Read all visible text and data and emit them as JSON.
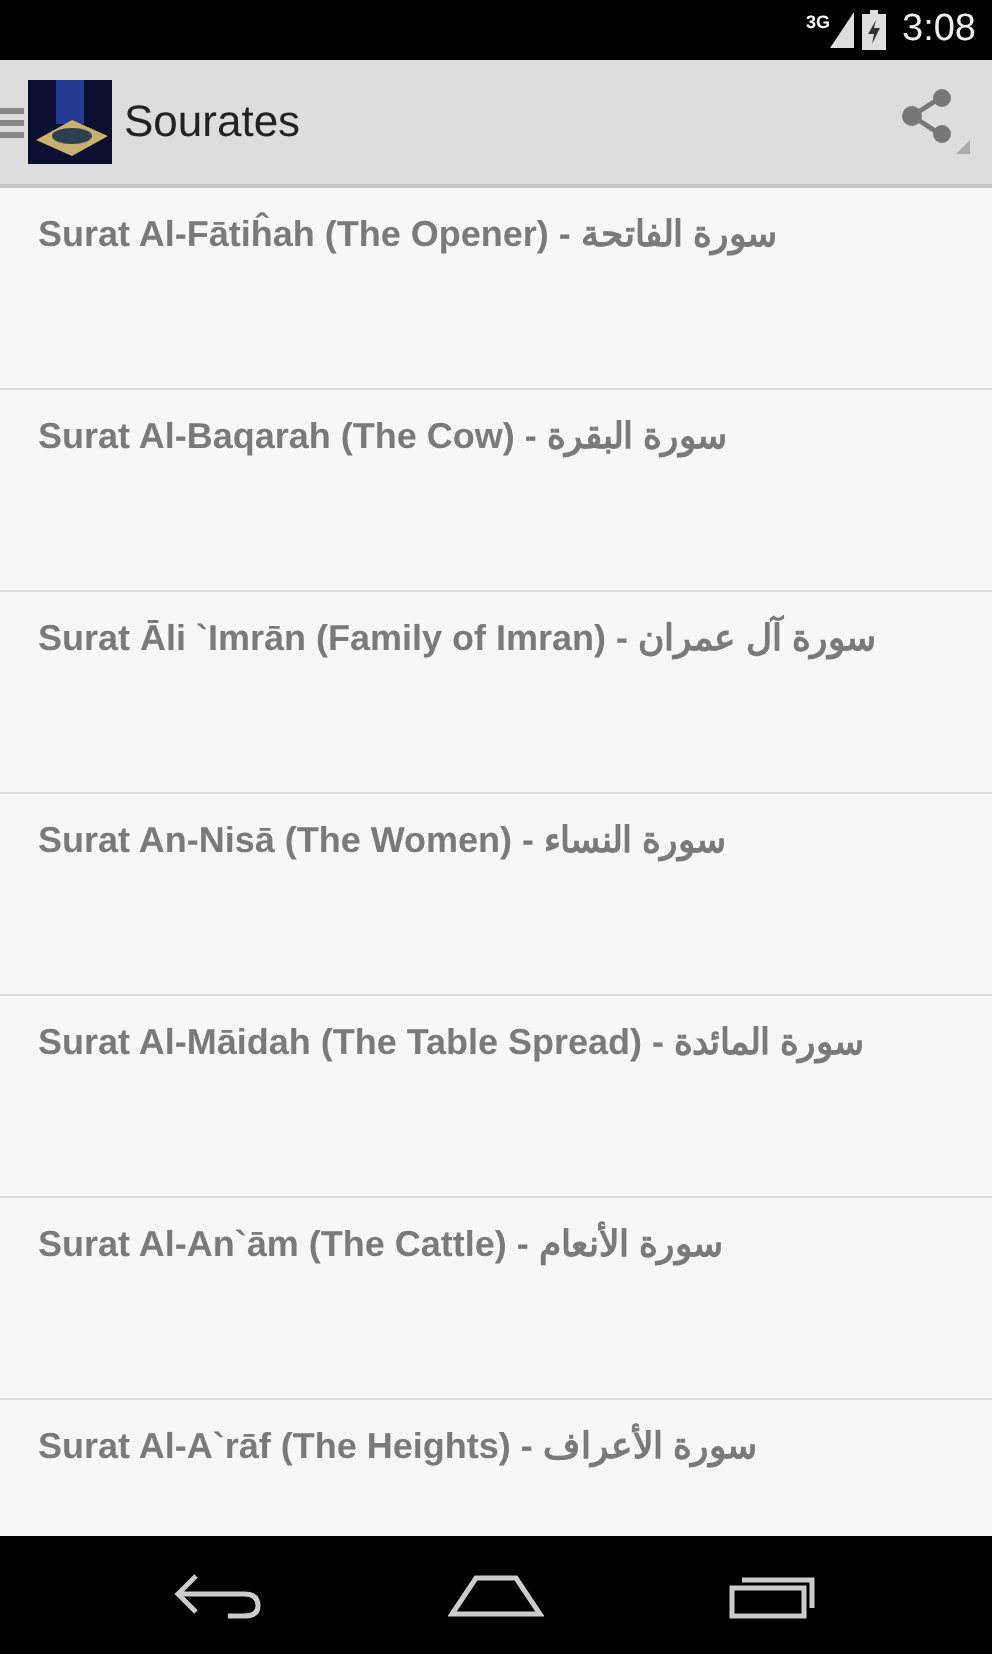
{
  "status_bar": {
    "network": "3G",
    "time": "3:08"
  },
  "action_bar": {
    "title": "Sourates"
  },
  "suras": [
    {
      "label": "Surat Al-Fātiĥah (The Opener) - سورة الفاتحة"
    },
    {
      "label": "Surat Al-Baqarah (The Cow) - سورة البقرة"
    },
    {
      "label": "Surat Āli `Imrān (Family of Imran) - سورة آل عمران"
    },
    {
      "label": "Surat An-Nisā (The Women) - سورة النساء"
    },
    {
      "label": "Surat Al-Māidah (The Table Spread) - سورة المائدة"
    },
    {
      "label": "Surat Al-An`ām (The Cattle) - سورة الأنعام"
    },
    {
      "label": "Surat Al-A`rāf (The Heights) - سورة الأعراف"
    }
  ]
}
